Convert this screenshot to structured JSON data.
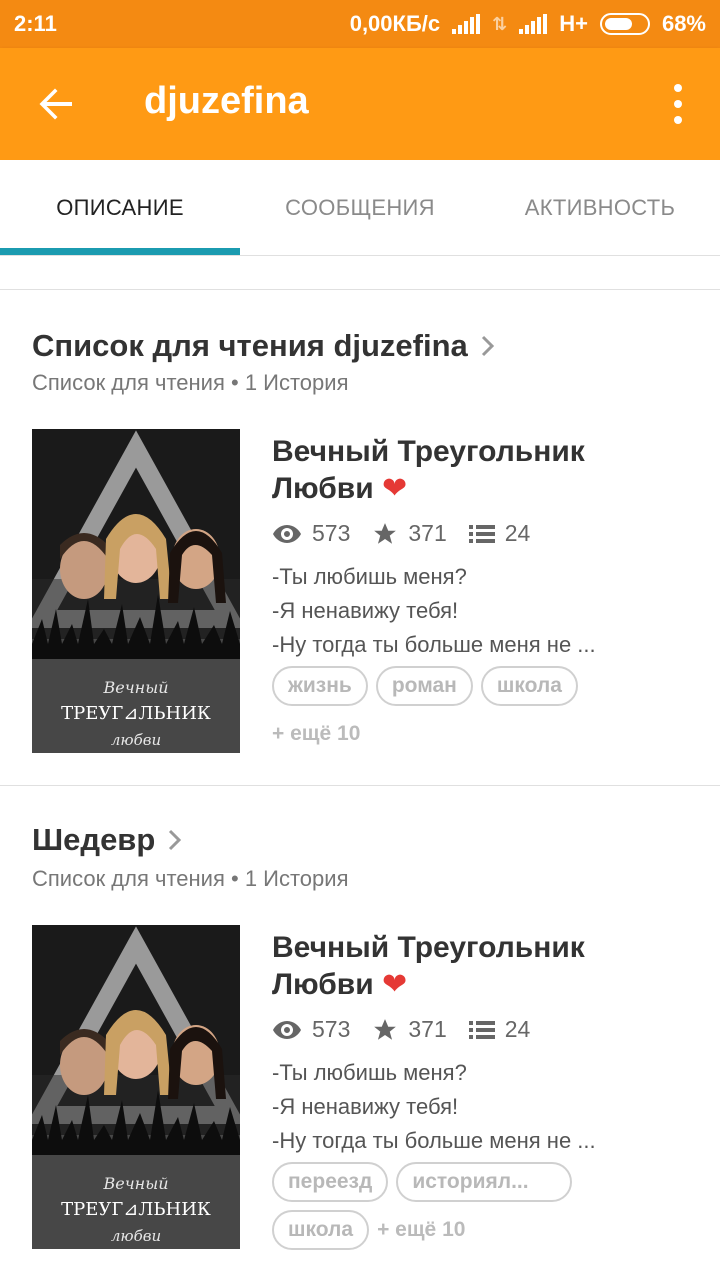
{
  "status_bar": {
    "time": "2:11",
    "speed": "0,00КБ/с",
    "network": "H+",
    "battery": "68%",
    "battery_level": 0.68
  },
  "app_bar": {
    "title": "djuzefina",
    "back_icon": "arrow-back-icon",
    "more_icon": "more-vertical-icon"
  },
  "tabs": [
    {
      "label": "ОПИСАНИЕ",
      "active": true
    },
    {
      "label": "СООБЩЕНИЯ",
      "active": false
    },
    {
      "label": "АКТИВНОСТЬ",
      "active": false
    }
  ],
  "lists": [
    {
      "title": "Список для чтения djuzefina",
      "subtitle": "Список для чтения • 1 История",
      "story": {
        "title_line1": "Вечный Треугольник",
        "title_line2": "Любви",
        "views": "573",
        "votes": "371",
        "parts": "24",
        "desc": [
          "-Ты любишь меня?",
          "-Я ненавижу тебя!",
          "-Ну тогда ты больше меня не ..."
        ],
        "tags": [
          "жизнь",
          "роман",
          "школа"
        ],
        "more_tags": "+ ещё 10",
        "cover_text": [
          "Вечный",
          "ТРЕУГ⊿ЛЬНИК",
          "любви"
        ]
      }
    },
    {
      "title": "Шедевр",
      "subtitle": "Список для чтения • 1 История",
      "story": {
        "title_line1": "Вечный Треугольник",
        "title_line2": "Любви",
        "views": "573",
        "votes": "371",
        "parts": "24",
        "desc": [
          "-Ты любишь меня?",
          "-Я ненавижу тебя!",
          "-Ну тогда ты больше меня не ..."
        ],
        "tags": [
          "переезд",
          "историял..."
        ],
        "tags_row2": [
          "школа"
        ],
        "more_tags": "+ ещё 10",
        "cover_text": [
          "Вечный",
          "ТРЕУГ⊿ЛЬНИК",
          "любви"
        ]
      }
    }
  ],
  "colors": {
    "status_bar": "#f48a12",
    "app_bar": "#ff9a14",
    "tab_indicator": "#1b9bb0",
    "heart": "#e53935"
  }
}
